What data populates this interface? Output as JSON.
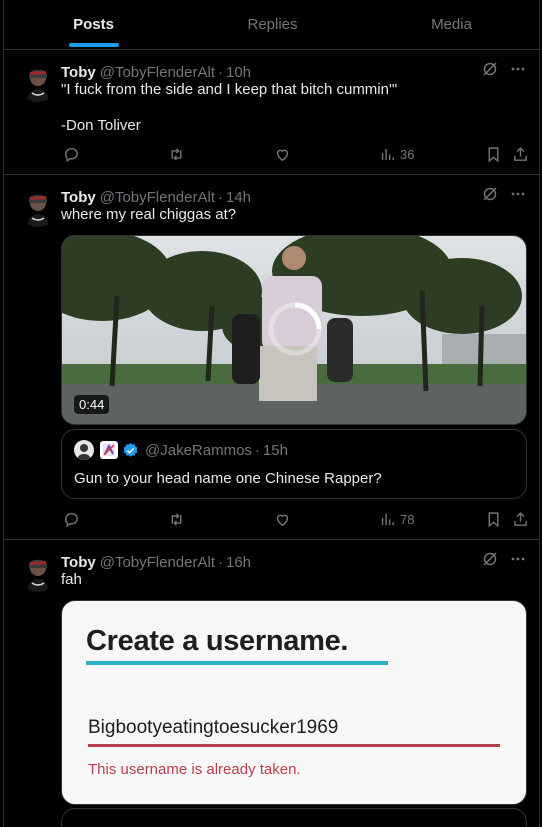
{
  "tabs": [
    {
      "label": "Posts",
      "active": true
    },
    {
      "label": "Replies",
      "active": false
    },
    {
      "label": "Media",
      "active": false
    }
  ],
  "posts": [
    {
      "author": "Toby",
      "handle": "@TobyFlenderAlt",
      "separator": "·",
      "time": "10h",
      "text": "\"I fuck from the side and I keep that bitch cummin'\"\n\n-Don Toliver",
      "views": "36"
    },
    {
      "author": "Toby",
      "handle": "@TobyFlenderAlt",
      "separator": "·",
      "time": "14h",
      "text": "where my real chiggas at?",
      "video_duration": "0:44",
      "quote": {
        "handle": "@JakeRammos",
        "separator": "·",
        "time": "15h",
        "text": "Gun to your head name one Chinese Rapper?"
      },
      "views": "78"
    },
    {
      "author": "Toby",
      "handle": "@TobyFlenderAlt",
      "separator": "·",
      "time": "16h",
      "text": "fah",
      "image": {
        "title": "Create a username.",
        "username": "Bigbootyeatingtoesucker1969",
        "error": "This username is already taken."
      }
    }
  ],
  "icons": {
    "grok": "grok-icon",
    "more": "more-icon",
    "reply": "reply-icon",
    "repost": "repost-icon",
    "like": "like-icon",
    "views": "views-icon",
    "bookmark": "bookmark-icon",
    "share": "share-icon",
    "verified": "verified-badge-icon"
  },
  "colors": {
    "accent": "#1d9bf0",
    "muted": "#71767b",
    "text": "#e7e9ea",
    "border": "#2f3336",
    "error": "#b5404d",
    "highlight": "#2bb3c5"
  }
}
